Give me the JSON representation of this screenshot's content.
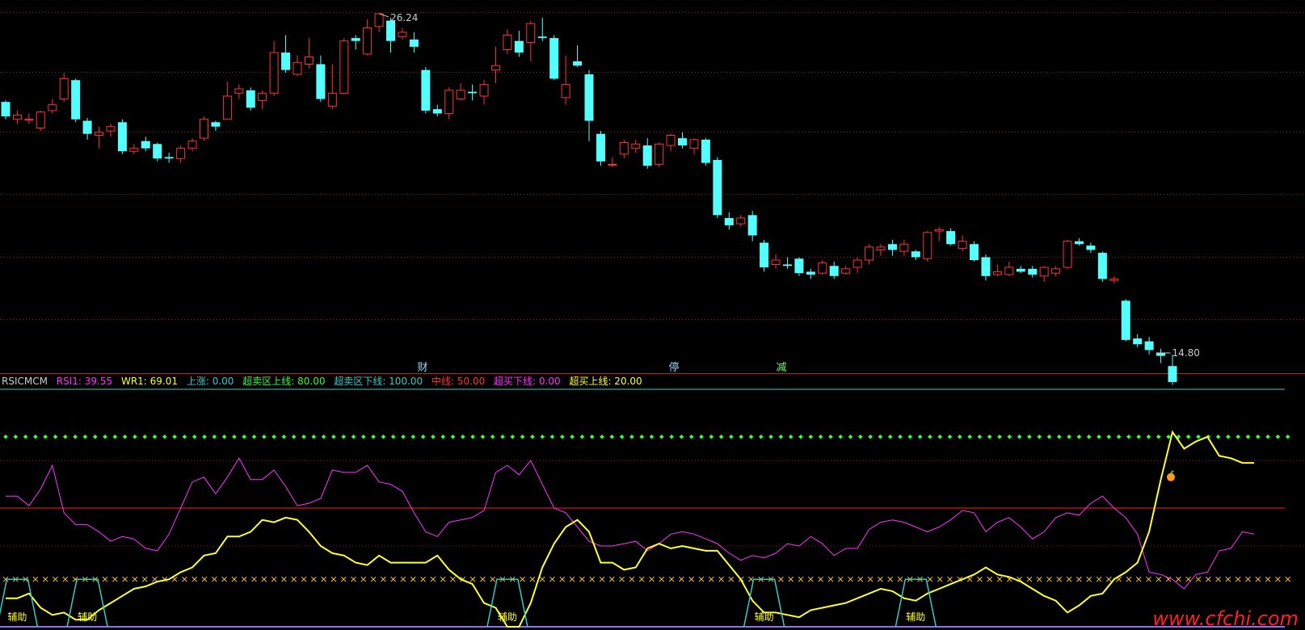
{
  "colors": {
    "background": "#000000",
    "candle_up": "#ff3232",
    "candle_down": "#54ffff",
    "grid": "#a01414",
    "separator": "#c81e1e",
    "wr_line": "#ffff33",
    "rsi_line": "#ff33ff",
    "overbought": "#33ff33",
    "midline": "#ff2020",
    "oversold_x": "#ffcc33",
    "top_line": "#33cccc",
    "bottom_line": "#9966ff",
    "trapezoid": "#33cccc",
    "assist_text": "#ffff33",
    "watermark": "#ff2020"
  },
  "price_panel": {
    "high_label": "26.24",
    "low_label": "14.80",
    "event_markers": [
      {
        "text": "财",
        "color": "#8fd8ff"
      },
      {
        "text": "停",
        "color": "#8fd8ff"
      },
      {
        "text": "减",
        "color": "#66ff66"
      }
    ]
  },
  "indicator": {
    "name": "RSICMCM",
    "legend": [
      {
        "text": "RSICMCM",
        "color": "#cccccc"
      },
      {
        "text": "RSI1: 39.55",
        "color": "#ff33ff"
      },
      {
        "text": "WR1: 69.01",
        "color": "#ffff33"
      },
      {
        "text": "上涨: 0.00",
        "color": "#33cccc"
      },
      {
        "text": "超卖区上线: 80.00",
        "color": "#33ff33"
      },
      {
        "text": "超卖区下线: 100.00",
        "color": "#33cccc"
      },
      {
        "text": "中线: 50.00",
        "color": "#ff3333"
      },
      {
        "text": "超买下线: 0.00",
        "color": "#ff33ff"
      },
      {
        "text": "超买上线: 20.00",
        "color": "#ffff33"
      }
    ],
    "assist_label": "辅助"
  },
  "watermark": "www.cfchi.com",
  "chart_data": [
    {
      "type": "candlestick",
      "ylim": [
        14.3,
        26.6
      ],
      "high": 26.24,
      "low": 14.8,
      "candles": [
        [
          23.2,
          22.7,
          23.25,
          22.6
        ],
        [
          22.6,
          22.75,
          22.9,
          22.45
        ],
        [
          22.6,
          22.6,
          22.8,
          22.45
        ],
        [
          22.3,
          22.85,
          22.9,
          22.2
        ],
        [
          22.9,
          23.1,
          23.3,
          22.8
        ],
        [
          23.3,
          24.0,
          24.2,
          23.2
        ],
        [
          23.95,
          22.6,
          24.0,
          22.5
        ],
        [
          22.55,
          22.1,
          22.65,
          21.9
        ],
        [
          22.05,
          22.15,
          22.35,
          21.6
        ],
        [
          22.2,
          22.35,
          22.45,
          22.0
        ],
        [
          22.5,
          21.5,
          22.6,
          21.4
        ],
        [
          21.5,
          21.6,
          21.75,
          21.4
        ],
        [
          21.85,
          21.6,
          22.0,
          21.5
        ],
        [
          21.75,
          21.25,
          21.8,
          21.15
        ],
        [
          21.3,
          21.25,
          21.45,
          21.1
        ],
        [
          21.25,
          21.6,
          21.7,
          21.1
        ],
        [
          21.6,
          21.85,
          21.95,
          21.5
        ],
        [
          21.95,
          22.6,
          22.7,
          21.85
        ],
        [
          22.5,
          22.35,
          22.55,
          22.2
        ],
        [
          22.6,
          23.4,
          23.9,
          22.6
        ],
        [
          23.5,
          23.65,
          23.8,
          23.3
        ],
        [
          23.6,
          23.0,
          23.7,
          22.9
        ],
        [
          23.25,
          23.5,
          23.6,
          22.95
        ],
        [
          23.5,
          24.9,
          25.3,
          23.4
        ],
        [
          24.9,
          24.3,
          25.5,
          24.2
        ],
        [
          24.15,
          24.55,
          24.8,
          24.1
        ],
        [
          24.5,
          24.75,
          25.4,
          24.35
        ],
        [
          24.5,
          23.3,
          24.8,
          23.2
        ],
        [
          23.05,
          23.5,
          24.5,
          22.95
        ],
        [
          23.5,
          25.3,
          25.4,
          23.45
        ],
        [
          25.4,
          25.3,
          25.5,
          25.0
        ],
        [
          24.85,
          25.75,
          26.05,
          24.8
        ],
        [
          25.8,
          26.24,
          26.24,
          25.6
        ],
        [
          26.0,
          25.3,
          26.1,
          24.9
        ],
        [
          25.45,
          25.6,
          25.75,
          25.35
        ],
        [
          25.35,
          25.1,
          25.6,
          24.9
        ],
        [
          24.3,
          22.9,
          24.4,
          22.8
        ],
        [
          22.95,
          22.8,
          23.1,
          22.7
        ],
        [
          22.8,
          23.6,
          23.7,
          22.6
        ],
        [
          23.3,
          23.6,
          23.85,
          23.25
        ],
        [
          23.55,
          23.5,
          23.8,
          23.25
        ],
        [
          23.4,
          23.8,
          23.95,
          23.1
        ],
        [
          24.3,
          24.45,
          25.1,
          23.85
        ],
        [
          25.0,
          25.5,
          25.7,
          24.85
        ],
        [
          25.3,
          24.9,
          25.65,
          24.75
        ],
        [
          25.25,
          25.9,
          26.0,
          24.6
        ],
        [
          25.45,
          25.4,
          26.1,
          25.3
        ],
        [
          25.4,
          24.0,
          25.5,
          23.95
        ],
        [
          23.35,
          23.8,
          24.8,
          23.1
        ],
        [
          24.6,
          24.45,
          25.15,
          24.4
        ],
        [
          24.15,
          22.55,
          24.3,
          21.85
        ],
        [
          22.1,
          21.15,
          22.2,
          21.0
        ],
        [
          21.05,
          21.05,
          21.3,
          20.95
        ],
        [
          21.4,
          21.8,
          21.9,
          21.25
        ],
        [
          21.6,
          21.75,
          21.9,
          21.45
        ],
        [
          21.7,
          21.0,
          21.95,
          20.9
        ],
        [
          21.05,
          21.75,
          21.8,
          20.95
        ],
        [
          21.7,
          22.05,
          22.1,
          21.5
        ],
        [
          21.95,
          21.7,
          22.15,
          21.6
        ],
        [
          21.6,
          21.9,
          21.95,
          21.4
        ],
        [
          21.9,
          21.1,
          21.95,
          21.0
        ],
        [
          21.2,
          19.3,
          21.3,
          19.2
        ],
        [
          19.2,
          18.95,
          19.4,
          18.8
        ],
        [
          19.0,
          19.2,
          19.3,
          18.9
        ],
        [
          19.3,
          18.6,
          19.45,
          18.4
        ],
        [
          18.35,
          17.5,
          18.45,
          17.35
        ],
        [
          17.6,
          17.75,
          17.95,
          17.45
        ],
        [
          17.6,
          17.55,
          17.85,
          17.45
        ],
        [
          17.8,
          17.3,
          17.85,
          17.2
        ],
        [
          17.35,
          17.25,
          17.45,
          17.1
        ],
        [
          17.3,
          17.65,
          17.75,
          17.25
        ],
        [
          17.55,
          17.2,
          17.7,
          17.1
        ],
        [
          17.3,
          17.45,
          17.55,
          17.25
        ],
        [
          17.5,
          17.75,
          17.85,
          17.3
        ],
        [
          17.75,
          18.2,
          18.3,
          17.6
        ],
        [
          18.1,
          18.2,
          18.3,
          17.9
        ],
        [
          18.3,
          18.1,
          18.45,
          17.9
        ],
        [
          18.05,
          18.3,
          18.45,
          17.9
        ],
        [
          18.05,
          17.85,
          18.1,
          17.75
        ],
        [
          17.8,
          18.7,
          18.75,
          17.7
        ],
        [
          18.75,
          18.8,
          18.9,
          18.4
        ],
        [
          18.75,
          18.3,
          18.85,
          18.25
        ],
        [
          18.15,
          18.4,
          18.6,
          18.05
        ],
        [
          18.3,
          17.75,
          18.4,
          17.7
        ],
        [
          17.85,
          17.2,
          17.95,
          17.05
        ],
        [
          17.25,
          17.35,
          17.6,
          17.2
        ],
        [
          17.25,
          17.5,
          17.7,
          17.2
        ],
        [
          17.45,
          17.35,
          17.55,
          17.3
        ],
        [
          17.45,
          17.25,
          17.55,
          17.15
        ],
        [
          17.2,
          17.5,
          17.55,
          17.0
        ],
        [
          17.3,
          17.45,
          17.55,
          17.2
        ],
        [
          17.5,
          18.4,
          18.45,
          17.45
        ],
        [
          18.4,
          18.3,
          18.5,
          18.25
        ],
        [
          18.25,
          18.1,
          18.35,
          18.0
        ],
        [
          18.0,
          17.1,
          18.05,
          17.0
        ],
        [
          17.05,
          17.1,
          17.2,
          16.95
        ],
        [
          16.35,
          15.0,
          16.4,
          14.95
        ],
        [
          15.05,
          14.85,
          15.2,
          14.75
        ],
        [
          14.95,
          14.65,
          15.1,
          14.5
        ],
        [
          14.55,
          14.45,
          14.7,
          14.2
        ],
        [
          14.1,
          13.55,
          14.5,
          13.45
        ]
      ]
    },
    {
      "type": "line",
      "title": "RSICMCM",
      "ylim": [
        0,
        100
      ],
      "reference_lines": {
        "超卖区上线": 80,
        "超卖区下线": 100,
        "中线": 50,
        "超买上线": 20,
        "超买下线": 0
      },
      "series": [
        {
          "name": "RSI1",
          "last_value": 39.55,
          "values": [
            55,
            55,
            51,
            58,
            68,
            48,
            43,
            43,
            40,
            36,
            38,
            37,
            33,
            32,
            39,
            50,
            61,
            63,
            56,
            63,
            71,
            62,
            62,
            66,
            59,
            51,
            52,
            54,
            66,
            65,
            65,
            68,
            61,
            60,
            57,
            48,
            40,
            38,
            44,
            45,
            46,
            49,
            65,
            68,
            64,
            70,
            60,
            50,
            48,
            42,
            36,
            34,
            34,
            35,
            36,
            32,
            35,
            39,
            40,
            39,
            37,
            35,
            31,
            28,
            30,
            29,
            31,
            35,
            34,
            38,
            35,
            30,
            33,
            33,
            41,
            44,
            45,
            44,
            42,
            40,
            42,
            45,
            49,
            48,
            40,
            44,
            46,
            42,
            37,
            40,
            46,
            48,
            47,
            52,
            55,
            50,
            46,
            39,
            23,
            22,
            20,
            16,
            22,
            23,
            32,
            33,
            40,
            39
          ]
        },
        {
          "name": "WR1",
          "last_value": 69.01,
          "values": [
            12,
            12,
            14,
            8,
            5,
            6,
            3,
            3,
            7,
            10,
            13,
            16,
            17,
            19,
            20,
            23,
            25,
            30,
            31,
            38,
            38,
            40,
            45,
            44,
            46,
            45,
            40,
            34,
            31,
            30,
            27,
            26,
            30,
            27,
            27,
            27,
            27,
            30,
            24,
            20,
            18,
            10,
            8,
            0,
            0,
            10,
            25,
            35,
            42,
            45,
            40,
            27,
            27,
            24,
            25,
            33,
            35,
            33,
            34,
            33,
            32,
            32,
            26,
            20,
            11,
            6,
            6,
            5,
            4,
            7,
            8,
            9,
            10,
            12,
            14,
            16,
            15,
            12,
            11,
            14,
            16,
            18,
            20,
            22,
            25,
            22,
            21,
            19,
            16,
            13,
            11,
            6,
            9,
            13,
            14,
            20,
            23,
            27,
            40,
            62,
            82,
            75,
            78,
            80,
            72,
            71,
            69,
            69
          ]
        }
      ],
      "assist_labels": [
        "辅助",
        "辅助",
        "辅助",
        "辅助",
        "辅助"
      ]
    }
  ]
}
